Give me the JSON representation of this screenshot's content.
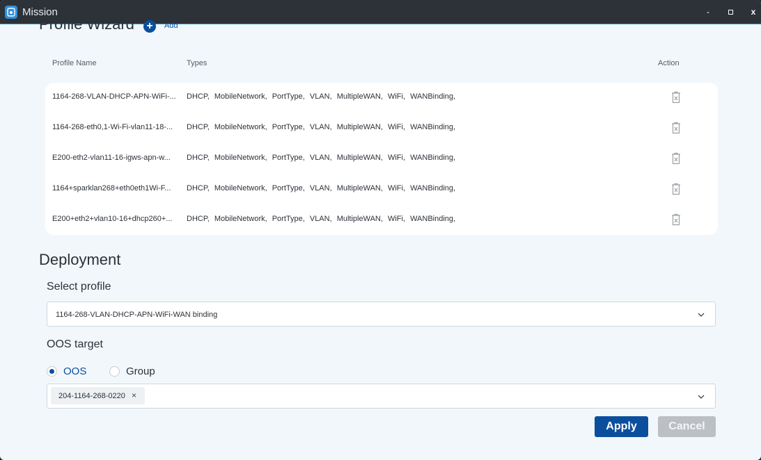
{
  "window": {
    "title": "Mission",
    "min_label": "-",
    "close_label": "x",
    "icon": "app-icon"
  },
  "wizard": {
    "heading": "Profile Wizard",
    "add_icon": "+",
    "add_label": "Add",
    "columns": {
      "name": "Profile Name",
      "types": "Types",
      "action": "Action"
    },
    "rows": [
      {
        "name": "1164-268-VLAN-DHCP-APN-WiFi-...",
        "types": "DHCP,  MobileNetwork,  PortType,  VLAN,  MultipleWAN,  WiFi,  WANBinding,"
      },
      {
        "name": "1164-268-eth0,1-Wi-Fi-vlan11-18-...",
        "types": "DHCP,  MobileNetwork,  PortType,  VLAN,  MultipleWAN,  WiFi,  WANBinding,"
      },
      {
        "name": "E200-eth2-vlan11-16-igws-apn-w...",
        "types": "DHCP,  MobileNetwork,  PortType,  VLAN,  MultipleWAN,  WiFi,  WANBinding,"
      },
      {
        "name": "1164+sparklan268+eth0eth1Wi-F...",
        "types": "DHCP,  MobileNetwork,  PortType,  VLAN,  MultipleWAN,  WiFi,  WANBinding,"
      },
      {
        "name": "E200+eth2+vlan10-16+dhcp260+...",
        "types": "DHCP,  MobileNetwork,  PortType,  VLAN,  MultipleWAN,  WiFi,  WANBinding,"
      }
    ]
  },
  "deployment": {
    "heading": "Deployment",
    "select_profile_label": "Select profile",
    "selected_profile": "1164-268-VLAN-DHCP-APN-WiFi-WAN binding",
    "target_label": "OOS target",
    "radio_oos": "OOS",
    "radio_group": "Group",
    "selected_radio": "OOS",
    "chip": "204-1164-268-0220",
    "chip_remove": "×",
    "apply": "Apply",
    "cancel": "Cancel"
  },
  "colors": {
    "primary": "#0b4f9c",
    "titlebar": "#2d3239",
    "background": "#f2f7fb"
  }
}
